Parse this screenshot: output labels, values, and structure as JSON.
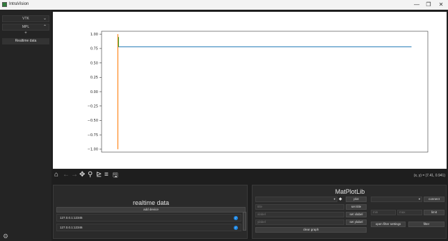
{
  "window": {
    "title": "IntraVision",
    "minimize": "—",
    "maximize": "❐",
    "close": "✕"
  },
  "sidebar": {
    "sections": [
      {
        "label": "VTK",
        "chevron": "⌄"
      },
      {
        "label": "MPL",
        "chevron": "⌃"
      }
    ],
    "plus": "+",
    "sub_items": [
      {
        "label": "Realtime data"
      }
    ],
    "settings_icon": "⚙"
  },
  "plot": {
    "yticks": [
      "1.00",
      "0.75",
      "0.50",
      "0.25",
      "0.00",
      "−0.25",
      "−0.50",
      "−0.75",
      "−1.00"
    ],
    "colors": {
      "series_blue": "#1f77b4",
      "series_orange": "#ff7f0e",
      "series_green": "#2ca02c"
    }
  },
  "chart_data": {
    "type": "line",
    "title": "",
    "xlabel": "",
    "ylabel": "",
    "ylim": [
      -1.05,
      1.05
    ],
    "xlim": [
      0,
      1
    ],
    "grid": false,
    "series": [
      {
        "color": "#1f77b4",
        "x": [
          0.05,
          0.95
        ],
        "y": [
          0.78,
          0.78
        ]
      },
      {
        "color": "#ff7f0e",
        "x": [
          0.05,
          0.05
        ],
        "y": [
          -1.0,
          1.0
        ]
      },
      {
        "color": "#2ca02c",
        "x": [
          0.052,
          0.052
        ],
        "y": [
          0.78,
          0.95
        ]
      }
    ]
  },
  "toolbar": {
    "home_icon": "⌂",
    "back_icon": "←",
    "forward_icon": "→",
    "pan_icon": "✥",
    "zoom_icon": "⚲",
    "subplots_icon": "⊵",
    "customize_icon": "≡",
    "save_icon": "🖫",
    "coords": "(x, y) = (7.41, 0.941)"
  },
  "realtime": {
    "title": "realtime data",
    "add_device": "add device",
    "devices": [
      {
        "address": "127.0.0.1:12345",
        "checked": true
      },
      {
        "address": "127.0.0.1:12346",
        "checked": true
      }
    ]
  },
  "matplotlib": {
    "title": "MatPlotLib",
    "plot_button": "plot",
    "connect_button": "connect",
    "title_placeholder": "title",
    "set_title": "set title",
    "xlabel_placeholder": "xlabel",
    "set_xlabel": "set xlabel",
    "ylabel_placeholder": "ylabel",
    "set_ylabel": "set ylabel",
    "clear_graph": "clear graph",
    "min_placeholder": "min",
    "max_placeholder": "max",
    "limit_button": "limit",
    "open_filter_settings": "open filter settings",
    "filter_button": "filter",
    "erase_icon": "◆"
  }
}
